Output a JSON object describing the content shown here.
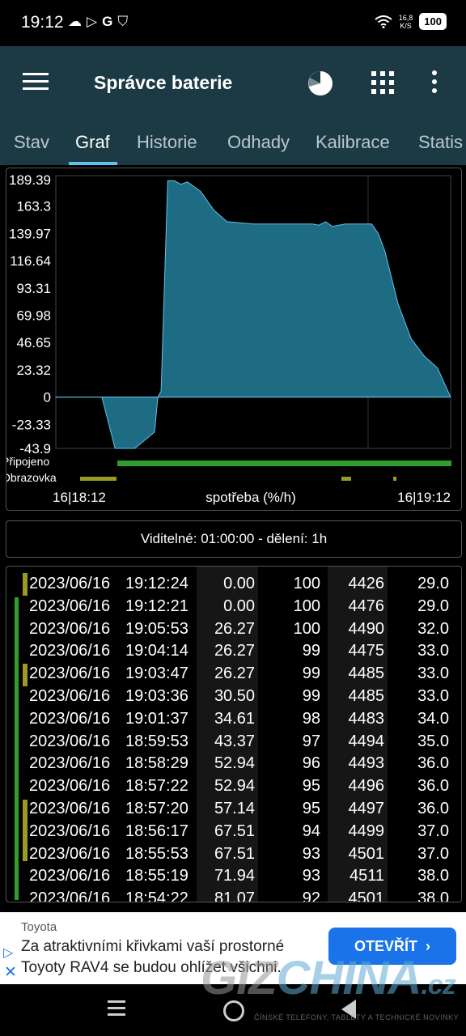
{
  "status_bar": {
    "time": "19:12",
    "left_icons": [
      "cloud-icon",
      "play-store-icon",
      "google-icon",
      "shield-icon"
    ],
    "speed_value": "16,8",
    "speed_unit": "K/S",
    "battery": "100"
  },
  "app_bar": {
    "title": "Správce baterie"
  },
  "tabs": [
    "Stav",
    "Graf",
    "Historie",
    "Odhady",
    "Kalibrace",
    "Statis"
  ],
  "graph": {
    "y_ticks": [
      "189.39",
      "163.3",
      "139.97",
      "116.64",
      "93.31",
      "69.98",
      "46.65",
      "23.32",
      "0",
      "-23.33",
      "-43.9"
    ],
    "label_pripojeno": "Připojeno",
    "label_obrazovka": "Obrazovka",
    "x_start": "16|18:12",
    "x_end": "16|19:12",
    "x_label": "spotřeba (%/h)",
    "fill_color": "#1e6b84",
    "line_color": "#5fc3e8",
    "connected_color": "#2f9e2f",
    "screen_color": "#9a9a25"
  },
  "chart_data": {
    "type": "area",
    "ylabel": "spotřeba (%/h)",
    "ylim": [
      -43.9,
      189.39
    ],
    "x_range": [
      "18:12",
      "19:12"
    ],
    "x": [
      "18:12",
      "18:19",
      "18:21",
      "18:24",
      "18:27",
      "18:27:30",
      "18:28",
      "18:29",
      "18:30",
      "18:31",
      "18:32",
      "18:34",
      "18:36",
      "18:38",
      "18:42",
      "18:48",
      "18:51",
      "18:52",
      "18:53",
      "18:54",
      "18:56",
      "18:58",
      "19:00",
      "19:01",
      "19:02",
      "19:04",
      "19:06",
      "19:08",
      "19:10",
      "19:12"
    ],
    "values": [
      0,
      0,
      -43.9,
      -43.9,
      -30,
      0,
      5,
      185,
      185,
      182,
      184,
      176,
      160,
      150,
      148,
      148,
      148,
      147,
      150,
      146,
      148,
      148,
      148,
      140,
      125,
      80,
      50,
      35,
      25,
      0
    ],
    "grid": true
  },
  "visible_info": "Viditelné: 01:00:00 - dělení: 1h",
  "history_rows": [
    {
      "date": "2023/06/16",
      "time": "19:12:24",
      "rate": "0.00",
      "level": "100",
      "mv": "4426",
      "temp": "29.0"
    },
    {
      "date": "2023/06/16",
      "time": "19:12:21",
      "rate": "0.00",
      "level": "100",
      "mv": "4476",
      "temp": "29.0"
    },
    {
      "date": "2023/06/16",
      "time": "19:05:53",
      "rate": "26.27",
      "level": "100",
      "mv": "4490",
      "temp": "32.0"
    },
    {
      "date": "2023/06/16",
      "time": "19:04:14",
      "rate": "26.27",
      "level": "99",
      "mv": "4475",
      "temp": "33.0"
    },
    {
      "date": "2023/06/16",
      "time": "19:03:47",
      "rate": "26.27",
      "level": "99",
      "mv": "4485",
      "temp": "33.0"
    },
    {
      "date": "2023/06/16",
      "time": "19:03:36",
      "rate": "30.50",
      "level": "99",
      "mv": "4485",
      "temp": "33.0"
    },
    {
      "date": "2023/06/16",
      "time": "19:01:37",
      "rate": "34.61",
      "level": "98",
      "mv": "4483",
      "temp": "34.0"
    },
    {
      "date": "2023/06/16",
      "time": "18:59:53",
      "rate": "43.37",
      "level": "97",
      "mv": "4494",
      "temp": "35.0"
    },
    {
      "date": "2023/06/16",
      "time": "18:58:29",
      "rate": "52.94",
      "level": "96",
      "mv": "4493",
      "temp": "36.0"
    },
    {
      "date": "2023/06/16",
      "time": "18:57:22",
      "rate": "52.94",
      "level": "95",
      "mv": "4496",
      "temp": "36.0"
    },
    {
      "date": "2023/06/16",
      "time": "18:57:20",
      "rate": "57.14",
      "level": "95",
      "mv": "4497",
      "temp": "36.0"
    },
    {
      "date": "2023/06/16",
      "time": "18:56:17",
      "rate": "67.51",
      "level": "94",
      "mv": "4499",
      "temp": "37.0"
    },
    {
      "date": "2023/06/16",
      "time": "18:55:53",
      "rate": "67.51",
      "level": "93",
      "mv": "4501",
      "temp": "37.0"
    },
    {
      "date": "2023/06/16",
      "time": "18:55:19",
      "rate": "71.94",
      "level": "93",
      "mv": "4511",
      "temp": "38.0"
    },
    {
      "date": "2023/06/16",
      "time": "18:54:22",
      "rate": "81.07",
      "level": "92",
      "mv": "4501",
      "temp": "38.0"
    }
  ],
  "ad": {
    "brand": "Toyota",
    "text_line1": "Za atraktivními křivkami vaší prostorné",
    "text_line2": "Toyoty RAV4 se budou ohlížet všichni.",
    "button": "OTEVŘÍT",
    "button_color": "#1a73e8"
  },
  "watermark": {
    "giz": "GIZ",
    "china": "CHINA",
    "cz": ".cz",
    "tagline": "ČÍNSKÉ TELEFONY, TABLETY A TECHNICKÉ NOVINKY"
  }
}
